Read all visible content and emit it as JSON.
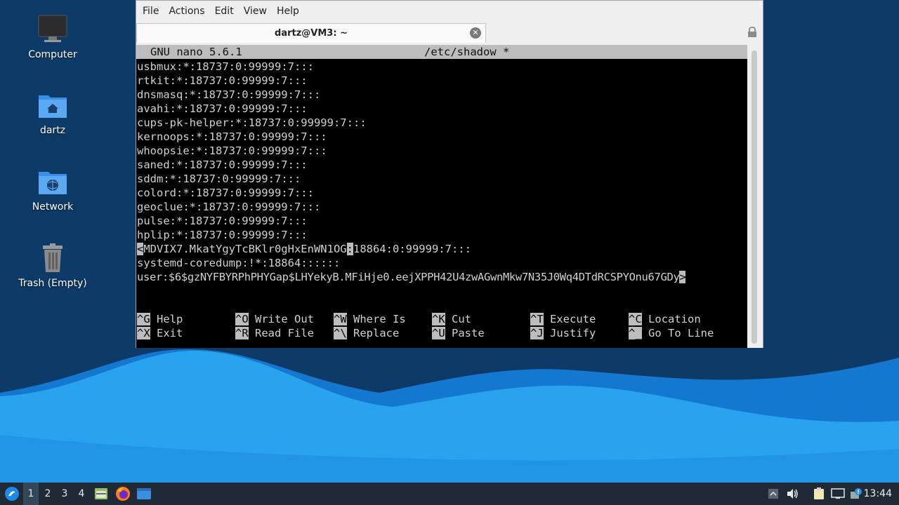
{
  "desktop": {
    "icons": [
      {
        "label": "Computer"
      },
      {
        "label": "dartz"
      },
      {
        "label": "Network"
      },
      {
        "label": "Trash (Empty)"
      }
    ]
  },
  "window": {
    "menu": [
      "File",
      "Actions",
      "Edit",
      "View",
      "Help"
    ],
    "tab_title": "dartz@VM3: ~",
    "tab_close_glyph": "✕"
  },
  "nano": {
    "version": "GNU nano 5.6.1",
    "filename": "/etc/shadow *",
    "lines": [
      "usbmux:*:18737:0:99999:7:::",
      "rtkit:*:18737:0:99999:7:::",
      "dnsmasq:*:18737:0:99999:7:::",
      "avahi:*:18737:0:99999:7:::",
      "cups-pk-helper:*:18737:0:99999:7:::",
      "kernoops:*:18737:0:99999:7:::",
      "whoopsie:*:18737:0:99999:7:::",
      "saned:*:18737:0:99999:7:::",
      "sddm:*:18737:0:99999:7:::",
      "colord:*:18737:0:99999:7:::",
      "geoclue:*:18737:0:99999:7:::",
      "pulse:*:18737:0:99999:7:::",
      "hplip:*:18737:0:99999:7:::"
    ],
    "cursor_line": {
      "lead_marker": "<",
      "before_cursor": "MDVIX7.MkatYgyTcBKlr0gHxEnWN1OG",
      "cursor_char": ":",
      "after_cursor": "18864:0:99999:7:::"
    },
    "line_coredump": "systemd-coredump:!*:18864::::::",
    "line_user": {
      "text": "user:$6$gzNYFBYRPhPHYGap$LHYekyB.MFiHje0.eejXPPH42U4zwAGwnMkw7N35J0Wq4DTdRCSPYOnu67GDy",
      "overflow_marker": ">"
    },
    "shortcuts": [
      {
        "key": "^G",
        "label": "Help"
      },
      {
        "key": "^O",
        "label": "Write Out"
      },
      {
        "key": "^W",
        "label": "Where Is"
      },
      {
        "key": "^K",
        "label": "Cut"
      },
      {
        "key": "^T",
        "label": "Execute"
      },
      {
        "key": "^C",
        "label": "Location"
      },
      {
        "key": "^X",
        "label": "Exit"
      },
      {
        "key": "^R",
        "label": "Read File"
      },
      {
        "key": "^\\",
        "label": "Replace"
      },
      {
        "key": "^U",
        "label": "Paste"
      },
      {
        "key": "^J",
        "label": "Justify"
      },
      {
        "key": "^_",
        "label": "Go To Line"
      }
    ]
  },
  "taskbar": {
    "workspaces": [
      "1",
      "2",
      "3",
      "4"
    ],
    "active_workspace": "1",
    "clock": "13:44"
  },
  "colors": {
    "desktop_dark": "#0d3a66",
    "wave_light": "#2aa3ee",
    "wave_mid": "#1578d0",
    "taskbar": "#1f2a36"
  }
}
